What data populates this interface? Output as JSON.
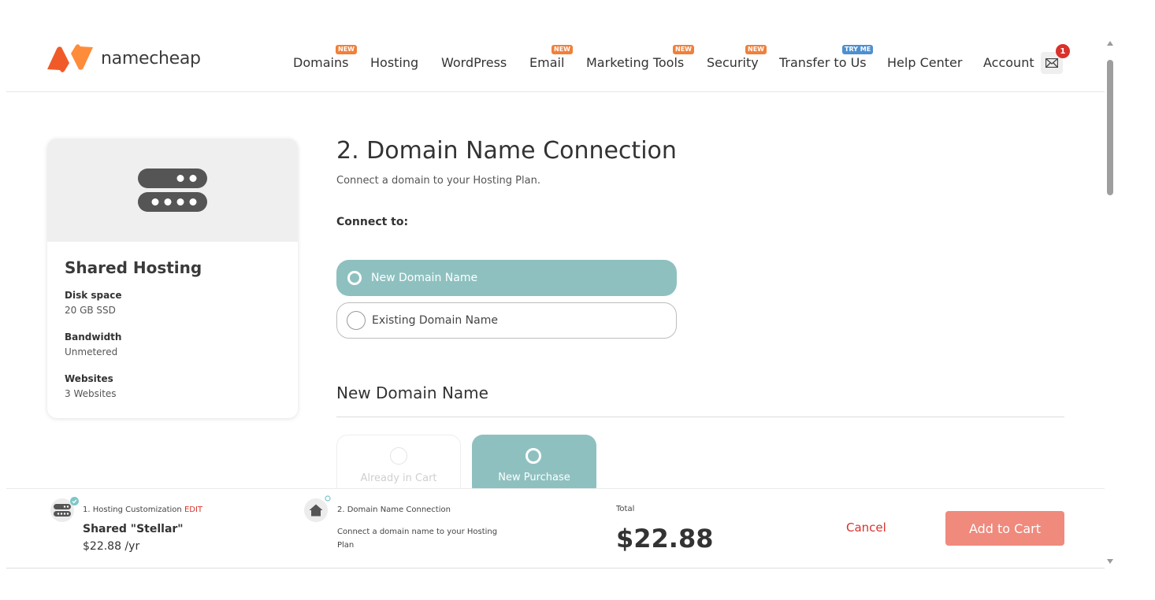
{
  "brand": {
    "name": "namecheap",
    "accent": "#f05a28",
    "badge_color": "#f0803b",
    "try_badge_color": "#4d8fd1"
  },
  "nav": {
    "items": [
      {
        "label": "Domains",
        "badge": "NEW"
      },
      {
        "label": "Hosting",
        "badge": ""
      },
      {
        "label": "WordPress",
        "badge": ""
      },
      {
        "label": "Email",
        "badge": "NEW"
      },
      {
        "label": "Marketing Tools",
        "badge": "NEW"
      },
      {
        "label": "Security",
        "badge": "NEW"
      },
      {
        "label": "Transfer to Us",
        "badge": "TRY ME"
      },
      {
        "label": "Help Center",
        "badge": ""
      },
      {
        "label": "Account",
        "badge": ""
      }
    ],
    "mail_count": "1"
  },
  "card": {
    "title": "Shared Hosting",
    "specs": [
      {
        "label": "Disk space",
        "value": "20 GB SSD"
      },
      {
        "label": "Bandwidth",
        "value": "Unmetered"
      },
      {
        "label": "Websites",
        "value": "3 Websites"
      }
    ]
  },
  "main": {
    "title": "2. Domain Name Connection",
    "subtitle": "Connect a domain to your Hosting Plan.",
    "connect_label": "Connect to:",
    "options": {
      "new": "New Domain Name",
      "existing": "Existing Domain Name"
    },
    "section_title": "New Domain Name",
    "choices": {
      "in_cart": "Already in Cart",
      "purchase": "New Purchase"
    }
  },
  "footer": {
    "step1_label": "1. Hosting Customization",
    "step1_edit": "EDIT",
    "plan_name": "Shared \"Stellar\"",
    "plan_price": "$22.88 /yr",
    "step2_label": "2. Domain Name Connection",
    "step2_desc": "Connect a domain name to your Hosting Plan",
    "total_label": "Total",
    "total_value": "$22.88",
    "cancel": "Cancel",
    "add_to_cart": "Add to Cart"
  }
}
